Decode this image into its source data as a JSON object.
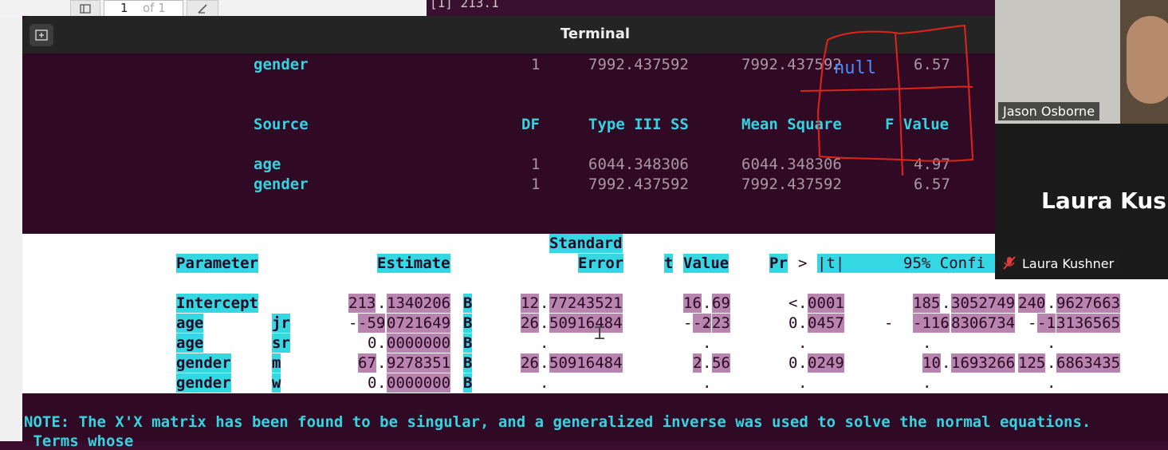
{
  "background": {
    "page_current": "1",
    "page_of": "of 1",
    "r_output": "[1] 213.1"
  },
  "window": {
    "title": "Terminal"
  },
  "annotation": {
    "text": "null"
  },
  "anova_top_row": {
    "name": "gender",
    "df": "1",
    "ss": "7992.437592",
    "ms": "7992.437592",
    "f": "6.57"
  },
  "anova_header": {
    "source": "Source",
    "df": "DF",
    "ss": "Type III SS",
    "ms": "Mean Square",
    "f": "F Value"
  },
  "anova_rows": [
    {
      "name": "age",
      "df": "1",
      "ss": "6044.348306",
      "ms": "6044.348306",
      "f": "4.97"
    },
    {
      "name": "gender",
      "df": "1",
      "ss": "7992.437592",
      "ms": "7992.437592",
      "f": "6.57"
    }
  ],
  "param_header": {
    "standard": "Standard",
    "parameter": "Parameter",
    "estimate": "Estimate",
    "error": "Error",
    "t": "t",
    "value": "Value",
    "pr": "Pr",
    "gt": ">",
    "abs_t": "|t|",
    "ci": "95% Confi"
  },
  "param_rows": [
    {
      "name": "Intercept",
      "level": "",
      "est_a": "213",
      "est_b": "1340206",
      "flag": "B",
      "se_a": "12",
      "se_b": "77243521",
      "t_a": "16",
      "t_b": "69",
      "pr_a": "<",
      "pr_b": "0001",
      "lo_a": "185",
      "lo_b": "3052749",
      "hi_a": "240",
      "hi_b": "9627663"
    },
    {
      "name": "age",
      "level": "jr",
      "est_a": "-59",
      "est_b": "0721649",
      "flag": "B",
      "se_a": "26",
      "se_b": "50916484",
      "t_a": "-2",
      "t_b": "23",
      "pr_a": "0",
      "pr_b": "0457",
      "lo_a": "-116",
      "lo_b": "8306734",
      "hi_a": "-1",
      "hi_b": "3136565"
    },
    {
      "name": "age",
      "level": "sr",
      "est_a": "0",
      "est_b": "0000000",
      "flag": "B",
      "se_a": "",
      "se_b": ".",
      "t_a": "",
      "t_b": ".",
      "pr_a": "",
      "pr_b": ".",
      "lo_a": "",
      "lo_b": ".",
      "hi_a": "",
      "hi_b": "."
    },
    {
      "name": "gender",
      "level": "m",
      "est_a": "67",
      "est_b": "9278351",
      "flag": "B",
      "se_a": "26",
      "se_b": "50916484",
      "t_a": "2",
      "t_b": "56",
      "pr_a": "0",
      "pr_b": "0249",
      "lo_a": "10",
      "lo_b": "1693266",
      "hi_a": "125",
      "hi_b": "6863435"
    },
    {
      "name": "gender",
      "level": "w",
      "est_a": "0",
      "est_b": "0000000",
      "flag": "B",
      "se_a": "",
      "se_b": ".",
      "t_a": "",
      "t_b": ".",
      "pr_a": "",
      "pr_b": ".",
      "lo_a": "",
      "lo_b": ".",
      "hi_a": "",
      "hi_b": "."
    }
  ],
  "note": {
    "label": "NOTE:",
    "text": " The X'X matrix has been found to be singular, and a generalized inverse was used to solve the normal equations.",
    "line2": " Terms whose"
  },
  "participants": {
    "p1": "Jason Osborne",
    "p2_big": "Laura Kush",
    "p2_label": "Laura Kushner"
  }
}
